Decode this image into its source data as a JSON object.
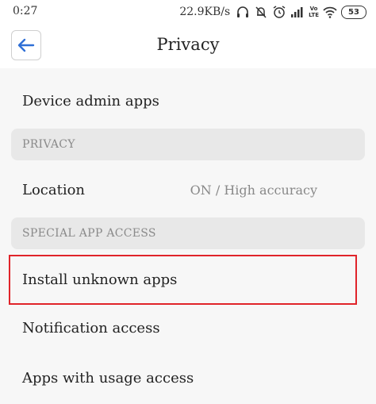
{
  "status_bar": {
    "time": "0:27",
    "net_speed": "22.9KB/s",
    "volte_line1": "Vo",
    "volte_line2": "LTE",
    "battery": "53"
  },
  "header": {
    "title": "Privacy",
    "back_icon": "back-arrow-icon"
  },
  "list": {
    "device_admin": "Device admin apps",
    "privacy_header": "PRIVACY",
    "location_label": "Location",
    "location_value": "ON / High accuracy",
    "special_access_header": "SPECIAL APP ACCESS",
    "install_unknown": "Install unknown apps",
    "notification_access": "Notification access",
    "usage_access": "Apps with usage access"
  },
  "colors": {
    "accent": "#2f6fd6",
    "highlight": "#e0242a",
    "section_bg": "#e8e8e8"
  }
}
